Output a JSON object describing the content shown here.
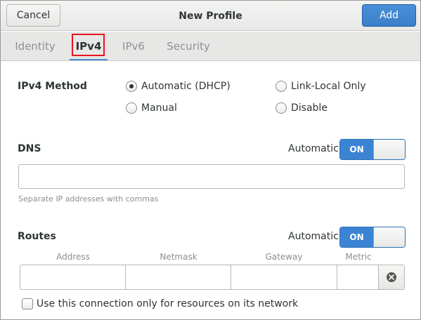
{
  "header": {
    "cancel_label": "Cancel",
    "title": "New Profile",
    "add_label": "Add",
    "accent_color": "#4a90d9"
  },
  "tabs": [
    {
      "label": "Identity",
      "active": false
    },
    {
      "label": "IPv4",
      "active": true
    },
    {
      "label": "IPv6",
      "active": false
    },
    {
      "label": "Security",
      "active": false
    }
  ],
  "ipv4_method": {
    "label": "IPv4 Method",
    "options": [
      {
        "label": "Automatic (DHCP)",
        "selected": true
      },
      {
        "label": "Link-Local Only",
        "selected": false
      },
      {
        "label": "Manual",
        "selected": false
      },
      {
        "label": "Disable",
        "selected": false
      }
    ]
  },
  "dns": {
    "label": "DNS",
    "automatic_label": "Automatic",
    "switch_state": "ON",
    "value": "",
    "hint": "Separate IP addresses with commas"
  },
  "routes": {
    "label": "Routes",
    "automatic_label": "Automatic",
    "switch_state": "ON",
    "columns": [
      "Address",
      "Netmask",
      "Gateway",
      "Metric"
    ],
    "row": {
      "address": "",
      "netmask": "",
      "gateway": "",
      "metric": ""
    }
  },
  "network_only": {
    "label": "Use this connection only for resources on its network",
    "checked": false
  }
}
